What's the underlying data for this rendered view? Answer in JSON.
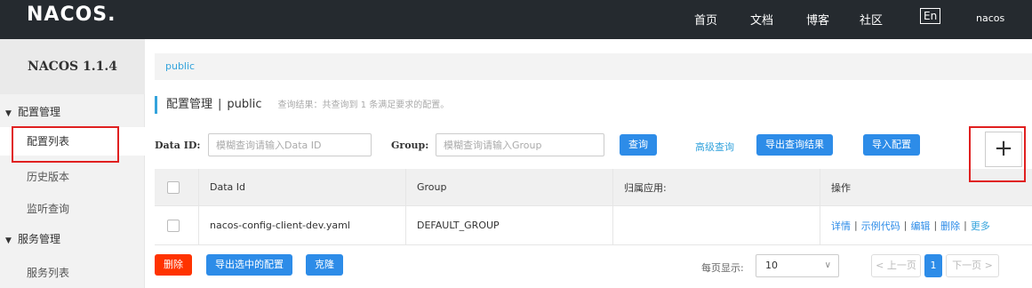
{
  "topbar": {
    "logo": "NACOS.",
    "nav": [
      "首页",
      "文档",
      "博客",
      "社区"
    ],
    "lang": "En",
    "user": "nacos"
  },
  "sidebar": {
    "version": "NACOS 1.1.4",
    "groups": [
      {
        "label": "配置管理",
        "items": [
          "配置列表",
          "历史版本",
          "监听查询"
        ]
      },
      {
        "label": "服务管理",
        "items": [
          "服务列表"
        ]
      }
    ],
    "active_item": "配置列表"
  },
  "breadcrumb": "public",
  "page": {
    "title": "配置管理",
    "separator": "|",
    "namespace": "public",
    "summary": "查询结果：共查询到 1 条满足要求的配置。"
  },
  "filters": {
    "data_id_label": "Data ID:",
    "data_id_placeholder": "模糊查询请输入Data ID",
    "group_label": "Group:",
    "group_placeholder": "模糊查询请输入Group",
    "query_button": "查询",
    "advanced_query": "高级查询",
    "export_results_button": "导出查询结果",
    "import_button": "导入配置",
    "add_icon": "+"
  },
  "table": {
    "columns": [
      "Data Id",
      "Group",
      "归属应用:",
      "操作"
    ],
    "rows": [
      {
        "data_id": "nacos-config-client-dev.yaml",
        "group": "DEFAULT_GROUP",
        "app": "",
        "ops": [
          "详情",
          "示例代码",
          "编辑",
          "删除",
          "更多"
        ]
      }
    ]
  },
  "footer": {
    "delete_button": "删除",
    "export_selected_button": "导出选中的配置",
    "clone_button": "克隆",
    "page_size_label": "每页显示:",
    "page_size_value": "10",
    "prev_button": "< 上一页",
    "current_page": "1",
    "next_button": "下一页 >"
  },
  "colors": {
    "topbar_bg": "#252a2f",
    "primary": "#2d8ce8",
    "danger": "#ff3300",
    "link": "#33a3dc",
    "highlight_outline": "#e02020"
  }
}
